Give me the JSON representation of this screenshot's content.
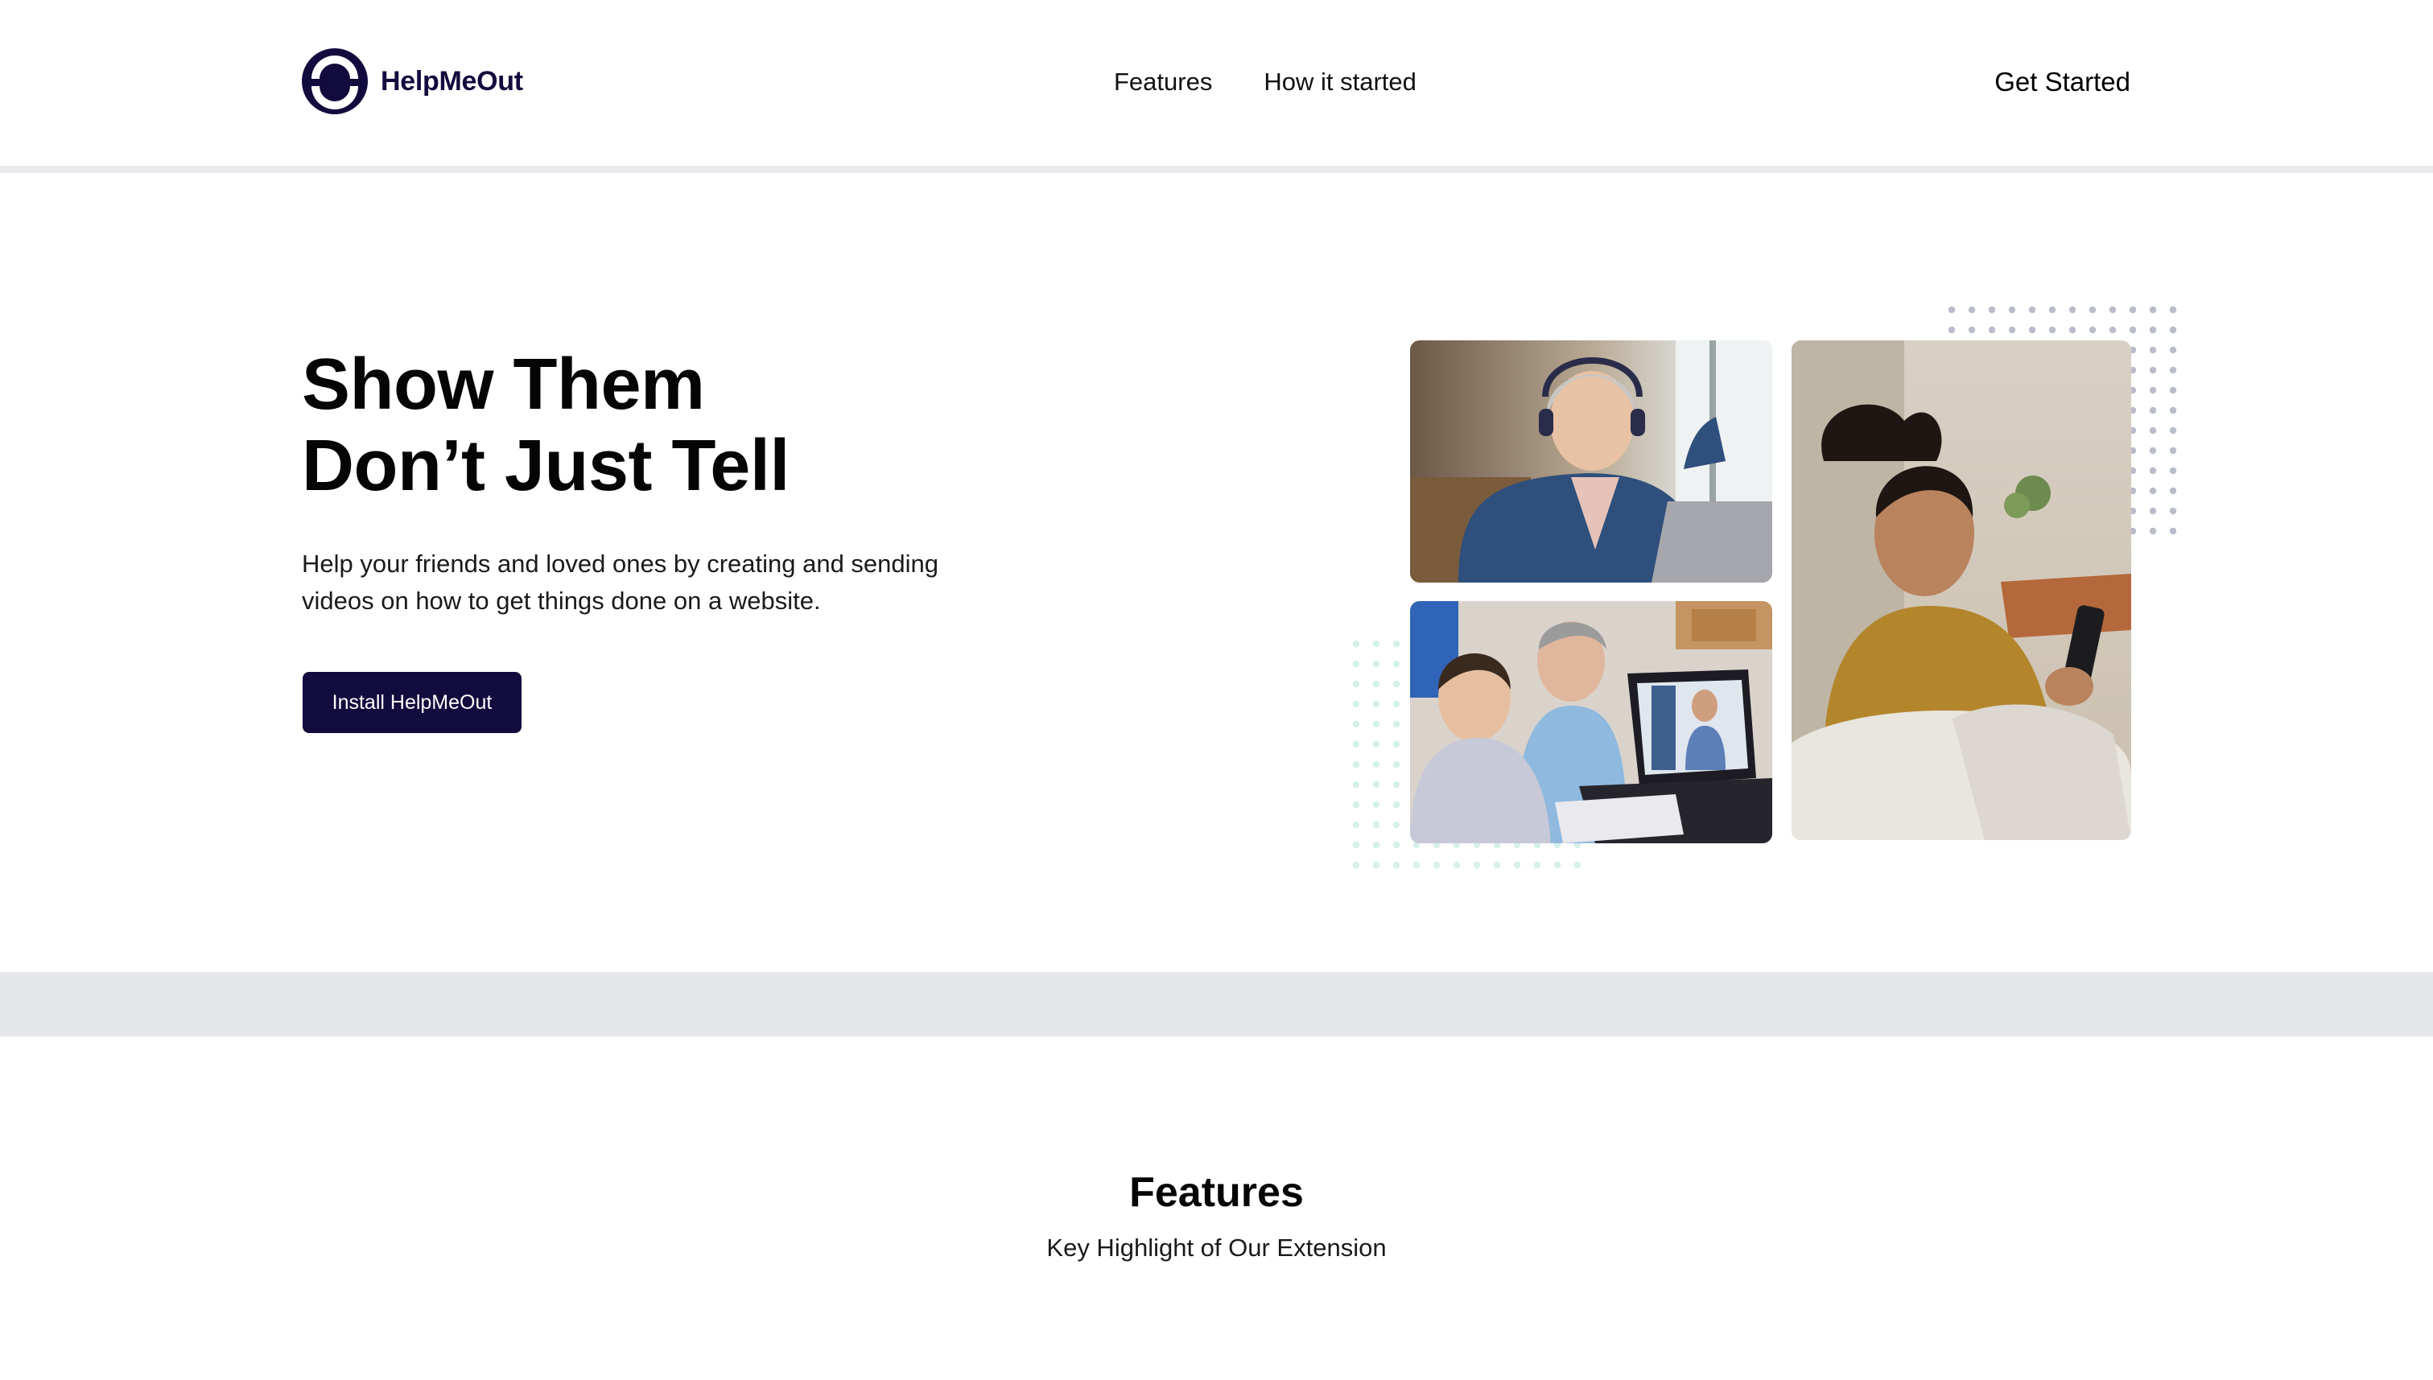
{
  "brand": {
    "name": "HelpMeOut",
    "color": "#120B3D"
  },
  "nav": {
    "items": [
      {
        "label": "Features"
      },
      {
        "label": "How it started"
      }
    ],
    "cta_label": "Get Started"
  },
  "hero": {
    "title_line1": "Show Them",
    "title_line2": "Don’t Just Tell",
    "subtitle": "Help your friends and loved ones by creating and sending videos on how to get things done on a website.",
    "install_label": "Install HelpMeOut"
  },
  "collage": {
    "photos": [
      {
        "icon": "woman-with-headphones-laptop-photo"
      },
      {
        "icon": "man-and-boy-video-call-photo"
      },
      {
        "icon": "woman-smiling-at-phone-photo"
      }
    ]
  },
  "features": {
    "title": "Features",
    "subtitle": "Key Highlight of Our Extension"
  },
  "colors": {
    "accent": "#120B3D",
    "band": "#E5E6E9",
    "divider": "#E9EAED",
    "dots_top": "#B9BCC9",
    "dots_bottom": "#D6F0EA"
  }
}
